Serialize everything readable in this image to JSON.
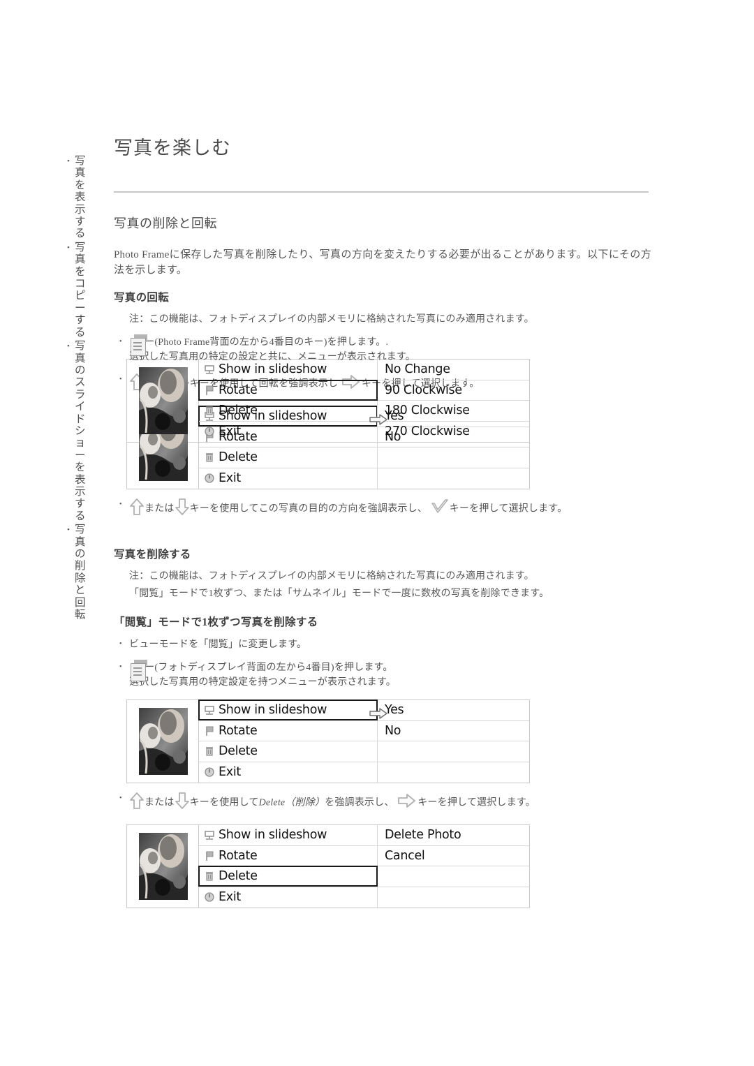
{
  "sidebar": {
    "items": [
      {
        "bullet": "•",
        "label": "写真を表示する"
      },
      {
        "bullet": "•",
        "label": "写真をコピーする"
      },
      {
        "bullet": "•",
        "label": "写真のスライドショーを表示する"
      },
      {
        "bullet": "•",
        "label": "写真の削除と回転"
      }
    ]
  },
  "page": {
    "title": "写真を楽しむ",
    "section_heading": "写真の削除と回転",
    "intro": "Photo  Frameに保存した写真を削除したり、写真の方向を変えたりする必要が出ることがあります。以下にその方法を示します。"
  },
  "rotate_section": {
    "heading": "写真の回転",
    "note": "注：この機能は、フォトディスプレイの内部メモリに格納された写真にのみ適用されます。",
    "step1_line1": "キー(Photo Frame背面の左から4番目のキー)を押します。.",
    "step1_line2": "選択した写真用の特定の設定と共に、メニューが表示されます。",
    "step2_part1": "または",
    "step2_part2": "キーを使用して回転を強調表示し",
    "step2_part3": "キーを押して選択します。",
    "step3_part1": "または",
    "step3_part2": "キーを使用してこの写真の目的の方向を強調表示し、",
    "step3_part3": "キーを押して選択します。"
  },
  "delete_section": {
    "heading": "写真を削除する",
    "note1": "注：この機能は、フォトディスプレイの内部メモリに格納された写真にのみ適用されます。",
    "note2": "「閲覧」モードで1枚ずつ、または「サムネイル」モードで一度に数枚の写真を削除できます。",
    "sub_heading": "「閲覧」モードで1枚ずつ写真を削除する",
    "step1": "ビューモードを「閲覧」に変更します。",
    "step2_line1": "キー(フォトディスプレイ背面の左から4番目)を押します。",
    "step2_line2": "選択した写真用の特定設定を持つメニューが表示されます。",
    "step3_part1": "または",
    "step3_part2": "キーを使用して",
    "step3_italic": "Delete（削除）",
    "step3_part3": "を強調表示し、",
    "step3_part4": "キーを押して選択します。"
  },
  "menus": [
    {
      "name": "menu-slideshow-yesno-1",
      "rows": [
        {
          "icon": "projector-icon",
          "label": "Show in slideshow",
          "value": "Yes",
          "selected": true,
          "pointer": true
        },
        {
          "icon": "flag-icon",
          "label": "Rotate",
          "value": "No",
          "selected": false,
          "pointer": false
        },
        {
          "icon": "trash-icon",
          "label": "Delete",
          "value": "",
          "selected": false,
          "pointer": false
        },
        {
          "icon": "power-icon",
          "label": "Exit",
          "value": "",
          "selected": false,
          "pointer": false
        }
      ]
    },
    {
      "name": "menu-rotate-options",
      "rows": [
        {
          "icon": "projector-icon",
          "label": "Show in slideshow",
          "value": "No Change",
          "selected": false,
          "pointer": false
        },
        {
          "icon": "flag-icon",
          "label": "Rotate",
          "value": "90 Clockwise",
          "selected": true,
          "pointer": false
        },
        {
          "icon": "trash-icon",
          "label": "Delete",
          "value": "180 Clockwise",
          "selected": false,
          "pointer": false
        },
        {
          "icon": "power-icon",
          "label": "Exit",
          "value": "270 Clockwise",
          "selected": false,
          "pointer": false
        }
      ]
    },
    {
      "name": "menu-slideshow-yesno-2",
      "rows": [
        {
          "icon": "projector-icon",
          "label": "Show in slideshow",
          "value": "Yes",
          "selected": true,
          "pointer": true
        },
        {
          "icon": "flag-icon",
          "label": "Rotate",
          "value": "No",
          "selected": false,
          "pointer": false
        },
        {
          "icon": "trash-icon",
          "label": "Delete",
          "value": "",
          "selected": false,
          "pointer": false
        },
        {
          "icon": "power-icon",
          "label": "Exit",
          "value": "",
          "selected": false,
          "pointer": false
        }
      ]
    },
    {
      "name": "menu-delete-options",
      "rows": [
        {
          "icon": "projector-icon",
          "label": "Show in slideshow",
          "value": "Delete Photo",
          "selected": false,
          "pointer": false
        },
        {
          "icon": "flag-icon",
          "label": "Rotate",
          "value": "Cancel",
          "selected": false,
          "pointer": false
        },
        {
          "icon": "trash-icon",
          "label": "Delete",
          "value": "",
          "selected": true,
          "pointer": false
        },
        {
          "icon": "power-icon",
          "label": "Exit",
          "value": "",
          "selected": false,
          "pointer": false
        }
      ]
    }
  ],
  "colors": {
    "text": "#4a4a4a",
    "rule": "#c8c8c8",
    "menu_text": "#111111",
    "icon_gray": "#9a9a9a",
    "border": "#c9c9c9"
  },
  "bullets": {
    "dot": "•"
  }
}
